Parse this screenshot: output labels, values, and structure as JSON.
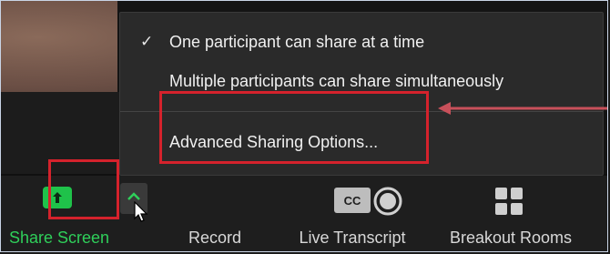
{
  "menu": {
    "items": [
      {
        "label": "One participant can share at a time",
        "checked": true
      },
      {
        "label": "Multiple participants can share simultaneously",
        "checked": false
      },
      {
        "label": "Advanced Sharing Options...",
        "checked": false
      }
    ],
    "check_glyph": "✓"
  },
  "toolbar": {
    "share_screen_label": "Share Screen",
    "record_label": "Record",
    "live_transcript_label": "Live Transcript",
    "cc_icon_text": "CC",
    "breakout_rooms_label": "Breakout Rooms"
  },
  "colors": {
    "share_green": "#1fc24a",
    "annotation_red": "#d5222c",
    "menu_bg": "#2a2a2a",
    "toolbar_bg": "#1e1e1e"
  }
}
